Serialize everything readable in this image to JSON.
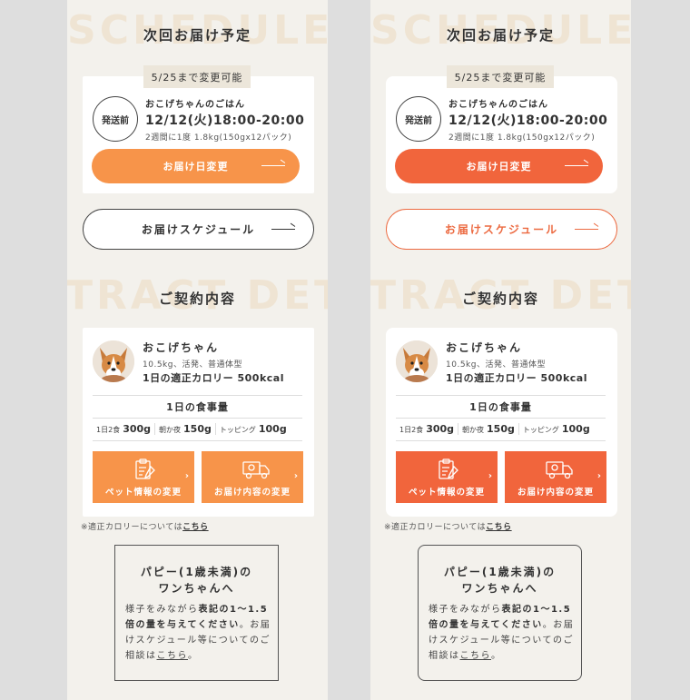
{
  "background_words": {
    "top": "SCHEDULE",
    "middle": "TRACT DET"
  },
  "schedule": {
    "title": "次回お届け予定",
    "deadline": "5/25まで変更可能",
    "status": "発送前",
    "food_name": "おこげちゃんのごはん",
    "delivery_date": "12/12(火)18:00-20:00",
    "plan": "2週間に1度 1.8kg(150gx12パック)",
    "change_button": "お届け日変更",
    "schedule_button": "お届けスケジュール"
  },
  "contract": {
    "title": "ご契約内容",
    "pet_name": "おこげちゃん",
    "pet_spec": "10.5kg、活発、普通体型",
    "calorie": "1日の適正カロリー 500kcal",
    "meal_title": "1日の食事量",
    "meals": [
      {
        "label": "1日2食",
        "value": "300g"
      },
      {
        "label": "朝か夜",
        "value": "150g"
      },
      {
        "label": "トッピング",
        "value": "100g"
      }
    ],
    "tiles": {
      "pet_info": "ペット情報の変更",
      "delivery": "お届け内容の変更"
    },
    "note_prefix": "※適正カロリーについては",
    "note_link": "こちら"
  },
  "puppy": {
    "title_line1": "パピー(1歳未満)の",
    "title_line2": "ワンちゃんへ",
    "body_1": "様子をみながら",
    "body_bold": "表記の1〜1.5倍の量を与えてください",
    "body_2": "。お届けスケジュール等についてのご相談は",
    "body_link": "こちら",
    "body_end": "。"
  },
  "colors": {
    "variant_a_accent": "#f7944a",
    "variant_b_accent": "#f1653c",
    "page_bg": "#f3f1ec"
  }
}
